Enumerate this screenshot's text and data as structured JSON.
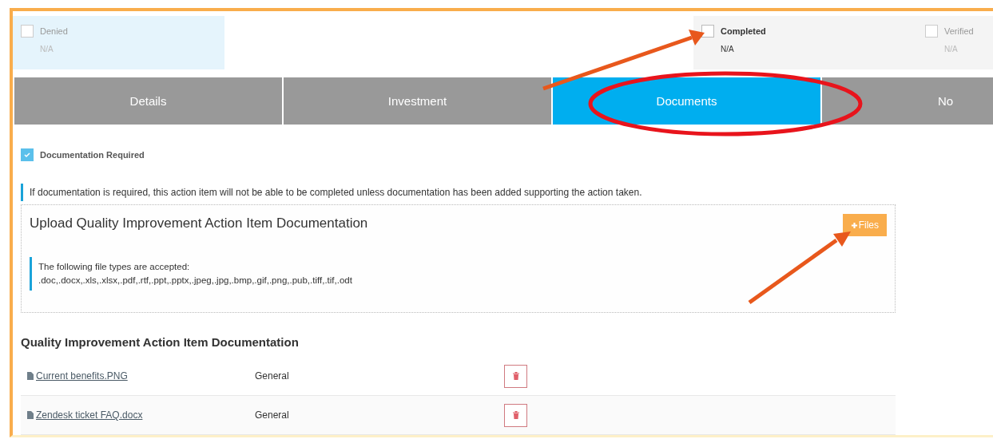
{
  "statuses": [
    {
      "label": "Denied",
      "value": "N/A",
      "checked": false,
      "disabled": true,
      "highlighted": true
    },
    {
      "label": "Completed",
      "value": "N/A",
      "checked": false,
      "disabled": false,
      "highlighted": false
    },
    {
      "label": "Verified",
      "value": "N/A",
      "checked": false,
      "disabled": true,
      "highlighted": false
    }
  ],
  "tabs": [
    {
      "label": "Details",
      "selected": false
    },
    {
      "label": "Investment",
      "selected": false
    },
    {
      "label": "Documents",
      "selected": true
    },
    {
      "label": "No",
      "selected": false
    }
  ],
  "documentation_required": {
    "label": "Documentation Required",
    "checked": true
  },
  "notice": "If documentation is required, this action item will not be able to be completed unless documentation has been added supporting the action taken.",
  "upload": {
    "title": "Upload Quality Improvement Action Item Documentation",
    "button": "Files",
    "accepted_label": "The following file types are accepted:",
    "accepted_types": ".doc,.docx,.xls,.xlsx,.pdf,.rtf,.ppt,.pptx,.jpeg,.jpg,.bmp,.gif,.png,.pub,.tiff,.tif,.odt"
  },
  "documents": {
    "title": "Quality Improvement Action Item Documentation",
    "rows": [
      {
        "file": "Current benefits.PNG",
        "category": "General"
      },
      {
        "file": "Zendesk ticket FAQ.docx",
        "category": "General"
      }
    ]
  }
}
